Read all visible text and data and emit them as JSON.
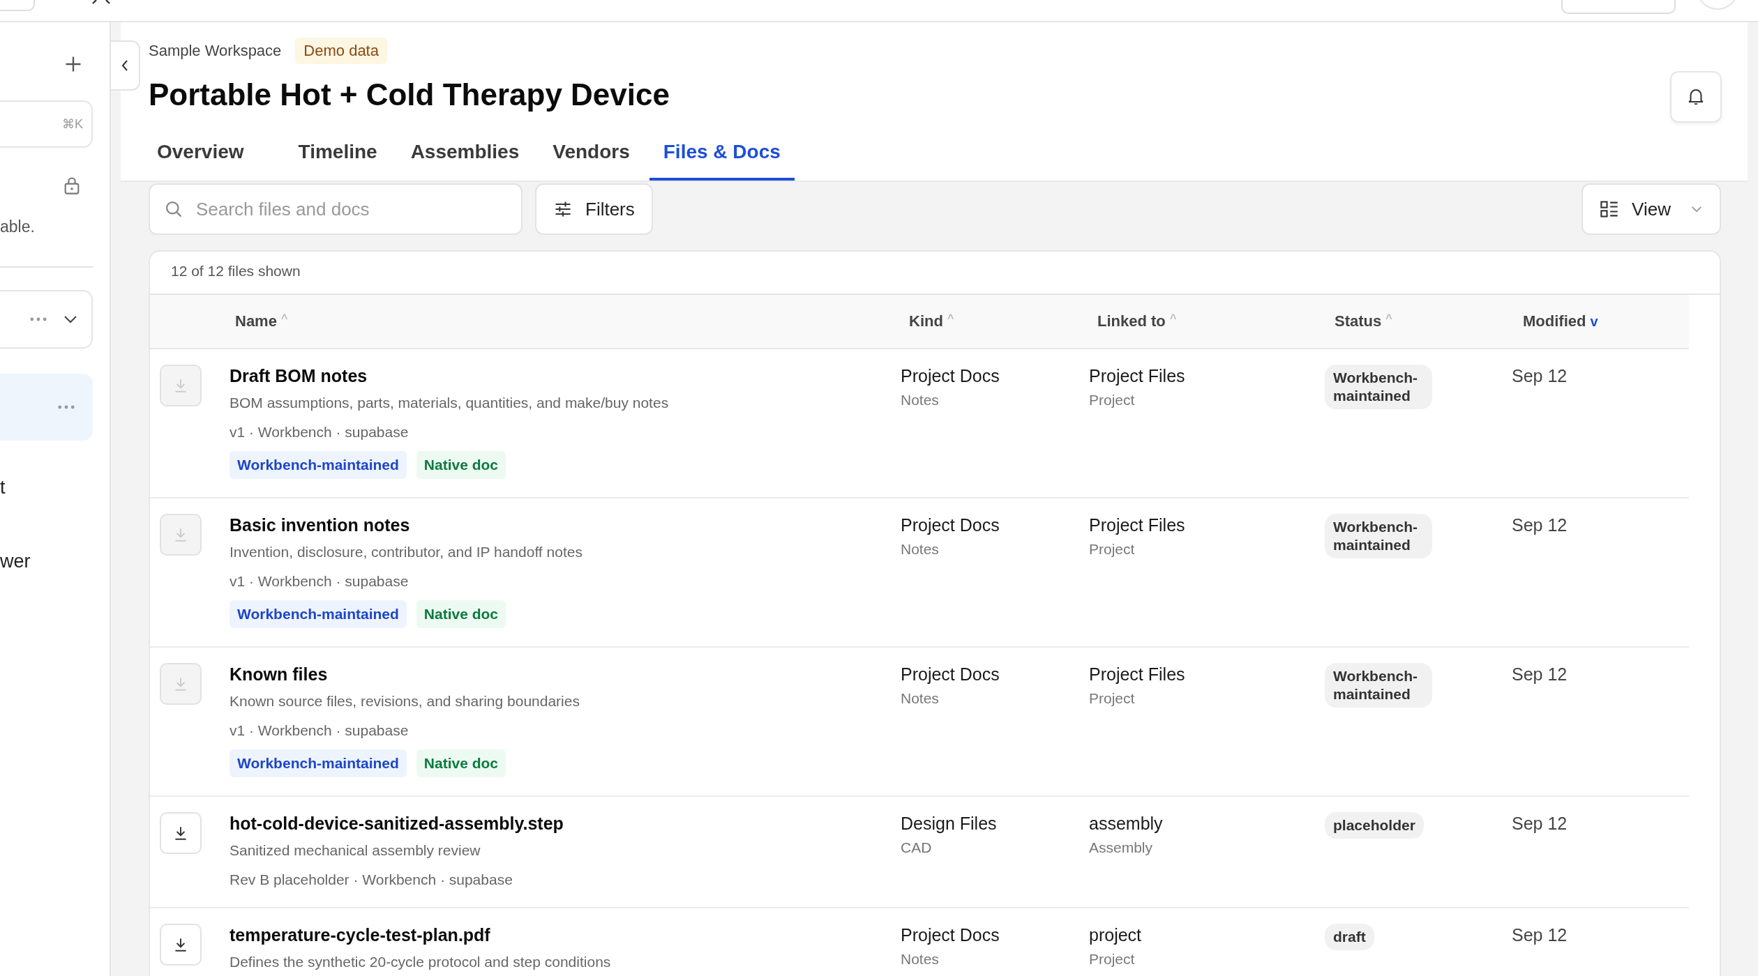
{
  "sidebar": {
    "search_shortcut": "⌘K",
    "note": "able.",
    "items": [
      {
        "label": "t",
        "selected": false
      },
      {
        "label": "wer",
        "selected": false
      }
    ]
  },
  "header": {
    "breadcrumb": "Sample Workspace",
    "badge": "Demo data",
    "title": "Portable Hot + Cold Therapy Device"
  },
  "tabs": [
    {
      "label": "Overview",
      "selected": false
    },
    {
      "label": "Timeline",
      "selected": false
    },
    {
      "label": "Assemblies",
      "selected": false
    },
    {
      "label": "Vendors",
      "selected": false
    },
    {
      "label": "Files & Docs",
      "selected": true
    }
  ],
  "search": {
    "placeholder": "Search files and docs"
  },
  "filters_button": "Filters",
  "view_button": "View",
  "table": {
    "summary": "12 of 12 files shown",
    "columns": [
      {
        "label": "Name",
        "sort_mark": "^",
        "active": false
      },
      {
        "label": "Kind",
        "sort_mark": "^",
        "active": false
      },
      {
        "label": "Linked to",
        "sort_mark": "^",
        "active": false
      },
      {
        "label": "Status",
        "sort_mark": "^",
        "active": false
      },
      {
        "label": "Modified",
        "sort_mark": "v",
        "active": true
      }
    ],
    "rows": [
      {
        "download_enabled": false,
        "name": "Draft BOM notes",
        "description": "BOM assumptions, parts, materials, quantities, and make/buy notes",
        "meta": "v1 · Workbench · supabase",
        "tags": [
          {
            "label": "Workbench-maintained",
            "kind": "maintained"
          },
          {
            "label": "Native doc",
            "kind": "native"
          }
        ],
        "kind": "Project Docs",
        "kind_sub": "Notes",
        "linked": "Project Files",
        "linked_sub": "Project",
        "status": "Workbench-maintained",
        "modified": "Sep 12"
      },
      {
        "download_enabled": false,
        "name": "Basic invention notes",
        "description": "Invention, disclosure, contributor, and IP handoff notes",
        "meta": "v1 · Workbench · supabase",
        "tags": [
          {
            "label": "Workbench-maintained",
            "kind": "maintained"
          },
          {
            "label": "Native doc",
            "kind": "native"
          }
        ],
        "kind": "Project Docs",
        "kind_sub": "Notes",
        "linked": "Project Files",
        "linked_sub": "Project",
        "status": "Workbench-maintained",
        "modified": "Sep 12"
      },
      {
        "download_enabled": false,
        "name": "Known files",
        "description": "Known source files, revisions, and sharing boundaries",
        "meta": "v1 · Workbench · supabase",
        "tags": [
          {
            "label": "Workbench-maintained",
            "kind": "maintained"
          },
          {
            "label": "Native doc",
            "kind": "native"
          }
        ],
        "kind": "Project Docs",
        "kind_sub": "Notes",
        "linked": "Project Files",
        "linked_sub": "Project",
        "status": "Workbench-maintained",
        "modified": "Sep 12"
      },
      {
        "download_enabled": true,
        "name": "hot-cold-device-sanitized-assembly.step",
        "description": "Sanitized mechanical assembly review",
        "meta": "Rev B placeholder · Workbench · supabase",
        "kind": "Design Files",
        "kind_sub": "CAD",
        "linked": "assembly",
        "linked_sub": "Assembly",
        "status": "placeholder",
        "modified": "Sep 12"
      },
      {
        "download_enabled": true,
        "name": "temperature-cycle-test-plan.pdf",
        "description": "Defines the synthetic 20-cycle protocol and step conditions",
        "meta": "",
        "kind": "Project Docs",
        "kind_sub": "Notes",
        "linked": "project",
        "linked_sub": "Project",
        "status": "draft",
        "modified": "Sep 12"
      }
    ]
  }
}
